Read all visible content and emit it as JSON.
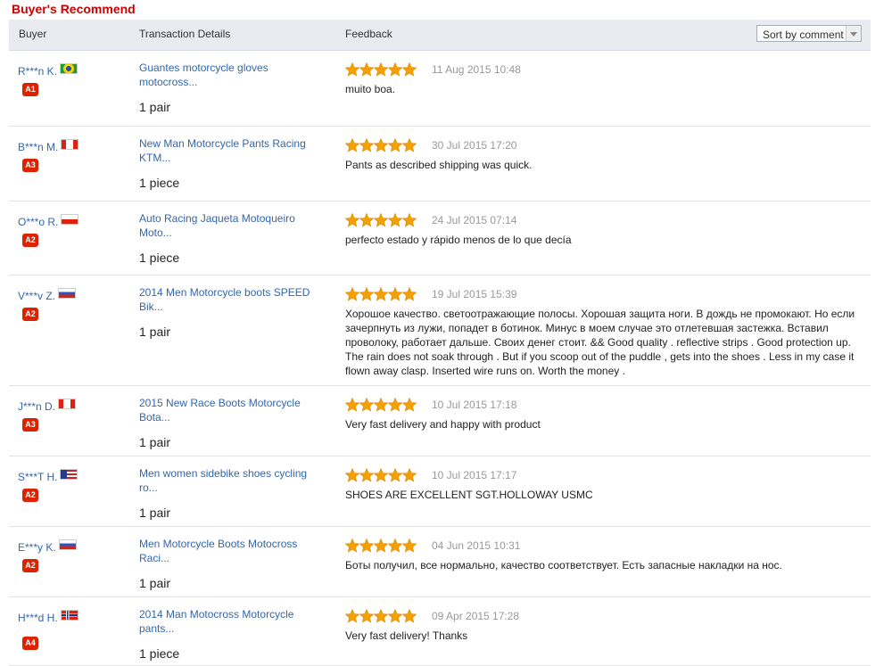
{
  "heading": "Buyer's Recommend",
  "columns": {
    "buyer": "Buyer",
    "transaction": "Transaction Details",
    "feedback": "Feedback"
  },
  "sort": {
    "label": "Sort by comment"
  },
  "colors": {
    "accent_red": "#cc0000",
    "link_blue": "#3366aa",
    "star_orange": "#f5a000",
    "badge_red": "#dd2200"
  },
  "reviews": [
    {
      "buyer": "R***n K.",
      "flag": "brazil-flag-icon",
      "level": "A1",
      "product_line1": "Guantes motorcycle gloves",
      "product_line2": "motocross...",
      "quantity": "1 pair",
      "stars": 5,
      "date": "11 Aug 2015 10:48",
      "comment": "muito boa."
    },
    {
      "buyer": "B***n M.",
      "flag": "canada-flag-icon",
      "level": "A3",
      "product_line1": "New Man Motorcycle Pants Racing",
      "product_line2": "KTM...",
      "quantity": "1 piece",
      "stars": 5,
      "date": "30 Jul 2015 17:20",
      "comment": "Pants as described shipping was quick."
    },
    {
      "buyer": "O***o R.",
      "flag": "chile-flag-icon",
      "level": "A2",
      "product_line1": "Auto Racing Jaqueta Motoqueiro",
      "product_line2": "Moto...",
      "quantity": "1 piece",
      "stars": 5,
      "date": "24 Jul 2015 07:14",
      "comment": "perfecto estado y rápido menos de lo que decía"
    },
    {
      "buyer": "V***v Z.",
      "flag": "russia-flag-icon",
      "level": "A2",
      "product_line1": "2014 Men Motorcycle boots SPEED",
      "product_line2": "Bik...",
      "quantity": "1 pair",
      "stars": 5,
      "date": "19 Jul 2015 15:39",
      "comment": "Хорошое качество. светоотражающие полосы. Хорошая защита ноги. В дождь не промокают. Но если зачерпнуть из лужи, попадет в ботинок. Минус в моем случае это отлетевшая застежка. Вставил проволоку, работает дальше. Своих денег стоит. && Good quality . reflective strips . Good protection up. The rain does not soak through . But if you scoop out of the puddle , gets into the shoes . Less in my case it flown away clasp. Inserted wire runs on. Worth the money ."
    },
    {
      "buyer": "J***n D.",
      "flag": "canada-flag-icon",
      "level": "A3",
      "product_line1": "2015 New Race Boots Motorcycle",
      "product_line2": "Bota...",
      "quantity": "1 pair",
      "stars": 5,
      "date": "10 Jul 2015 17:18",
      "comment": "Very fast delivery and happy with product"
    },
    {
      "buyer": "S***T H.",
      "flag": "usa-flag-icon",
      "level": "A2",
      "product_line1": "Men women sidebike shoes cycling",
      "product_line2": "ro...",
      "quantity": "1 pair",
      "stars": 5,
      "date": "10 Jul 2015 17:17",
      "comment": "SHOES ARE EXCELLENT SGT.HOLLOWAY USMC"
    },
    {
      "buyer": "E***y K.",
      "flag": "russia-flag-icon",
      "level": "A2",
      "product_line1": "Men Motorcycle Boots Motocross",
      "product_line2": "Raci...",
      "quantity": "1 pair",
      "stars": 5,
      "date": "04 Jun 2015 10:31",
      "comment": "Боты получил, все нормально, качество соответствует. Есть запасные накладки на нос."
    },
    {
      "buyer": "H***d H.",
      "flag": "norway-flag-icon",
      "level": "A4",
      "product_line1": "2014 Man Motocross Motorcycle",
      "product_line2": "pants...",
      "quantity": "1 piece",
      "stars": 5,
      "date": "09 Apr 2015 17:28",
      "comment": "Very fast delivery! Thanks"
    }
  ]
}
